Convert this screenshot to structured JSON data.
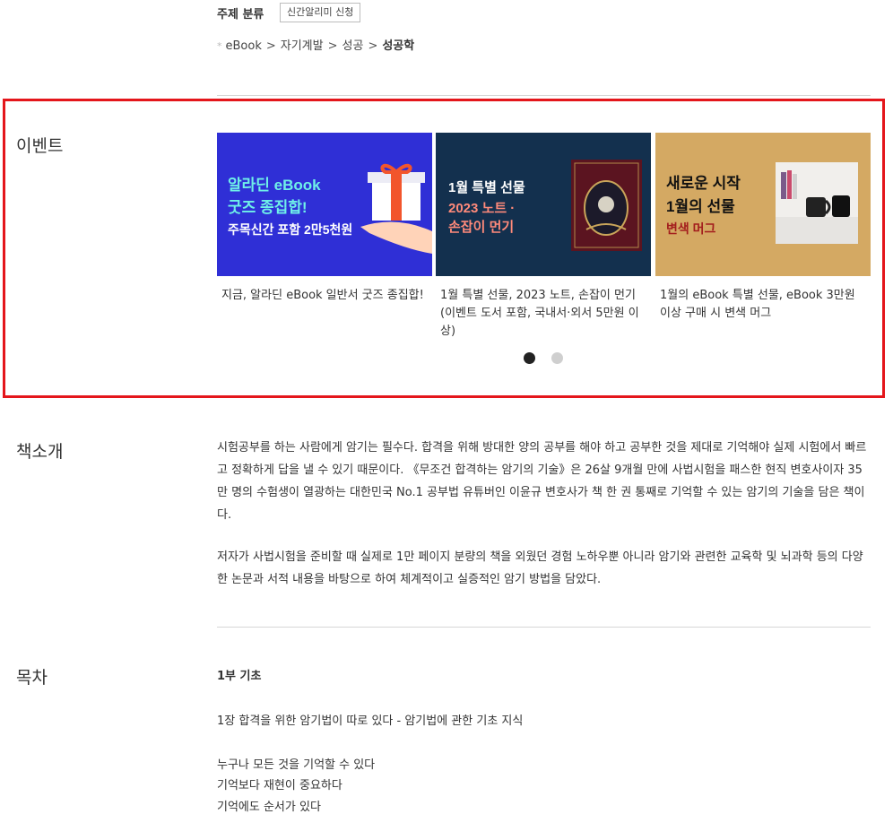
{
  "subject": {
    "title": "주제 분류",
    "alert_button": "신간알리미 신청",
    "bullet": "*",
    "breadcrumb": [
      "eBook",
      "자기계발",
      "성공",
      "성공학"
    ]
  },
  "event": {
    "label": "이벤트",
    "banners": [
      {
        "lines": [
          "알라딘 eBook",
          "굿즈 종집합!",
          "주목신간 포함 2만5천원"
        ],
        "caption": "지금, 알라딘 eBook 일반서 굿즈 종집합!",
        "bg": "#2f2fd6"
      },
      {
        "lines": [
          "1월 특별 선물",
          "2023 노트 ·",
          "손잡이 먼기"
        ],
        "caption": "1월 특별 선물, 2023 노트, 손잡이 먼기 (이벤트 도서 포함, 국내서·외서 5만원 이상)",
        "bg": "#13304e"
      },
      {
        "lines": [
          "새로운 시작",
          "1월의 선물",
          "변색 머그"
        ],
        "caption": "1월의 eBook 특별 선물, eBook 3만원 이상 구매 시 변색 머그",
        "bg": "#d4a963"
      }
    ],
    "pagination": {
      "active": 1,
      "total": 2
    }
  },
  "intro": {
    "label": "책소개",
    "p1": "시험공부를 하는 사람에게 암기는 필수다. 합격을 위해 방대한 양의 공부를 해야 하고 공부한 것을 제대로 기억해야 실제 시험에서 빠르고 정확하게 답을 낼 수 있기 때문이다. 《무조건 합격하는 암기의 기술》은 26살 9개월 만에 사법시험을 패스한 현직 변호사이자 35만 명의 수험생이 열광하는 대한민국 No.1 공부법 유튜버인 이윤규 변호사가 책 한 권 통째로 기억할 수 있는 암기의 기술을 담은 책이다.",
    "p2": "저자가 사법시험을 준비할 때 실제로 1만 페이지 분량의 책을 외웠던 경험 노하우뿐 아니라 암기와 관련한 교육학 및 뇌과학 등의 다양한 논문과 서적 내용을 바탕으로 하여 체계적이고 실증적인 암기 방법을 담았다."
  },
  "toc": {
    "label": "목차",
    "part": "1부 기초",
    "chapter": "1장 합격을 위한 암기법이 따로 있다 - 암기법에 관한 기초 지식",
    "items": [
      "누구나 모든 것을 기억할 수 있다",
      "기억보다 재현이 중요하다",
      "기억에도 순서가 있다"
    ]
  }
}
